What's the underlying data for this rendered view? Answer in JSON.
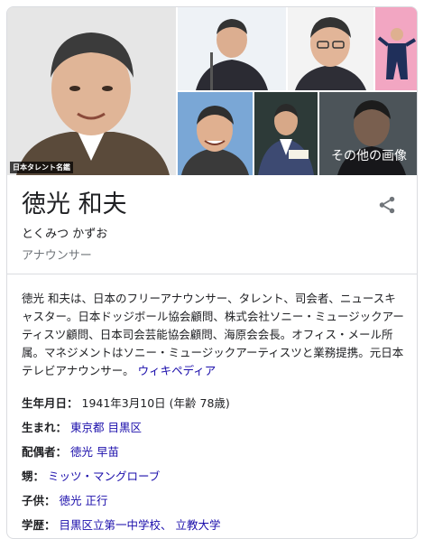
{
  "images": {
    "main_credit": "日本タレント名鑑",
    "more_images_label": "その他の画像"
  },
  "entity": {
    "name": "徳光 和夫",
    "reading": "とくみつ かずお",
    "type": "アナウンサー"
  },
  "description": {
    "text": "徳光 和夫は、日本のフリーアナウンサー、タレント、司会者、ニュースキャスター。日本ドッジボール協会顧問、株式会社ソニー・ミュージックアーティスツ顧問、日本司会芸能協会顧問、海原会会長。オフィス・メール所属。マネジメントはソニー・ミュージックアーティスツと業務提携。元日本テレビアナウンサー。",
    "source": "ウィキペディア"
  },
  "facts": {
    "born": {
      "label": "生年月日：",
      "value": "1941年3月10日 (年齢 78歳)"
    },
    "birthplace": {
      "label": "生まれ：",
      "value": "東京都 目黒区"
    },
    "spouse": {
      "label": "配偶者：",
      "value": "徳光 早苗"
    },
    "nephew": {
      "label": "甥：",
      "value": "ミッツ・マングローブ"
    },
    "children": {
      "label": "子供：",
      "value": "徳光 正行"
    },
    "education": {
      "label": "学歴：",
      "value": "目黒区立第一中学校、 立教大学"
    }
  },
  "icons": {
    "share": "share-icon"
  },
  "colors": {
    "link": "#1a0dab",
    "muted": "#70757a",
    "border": "#dadce0"
  }
}
